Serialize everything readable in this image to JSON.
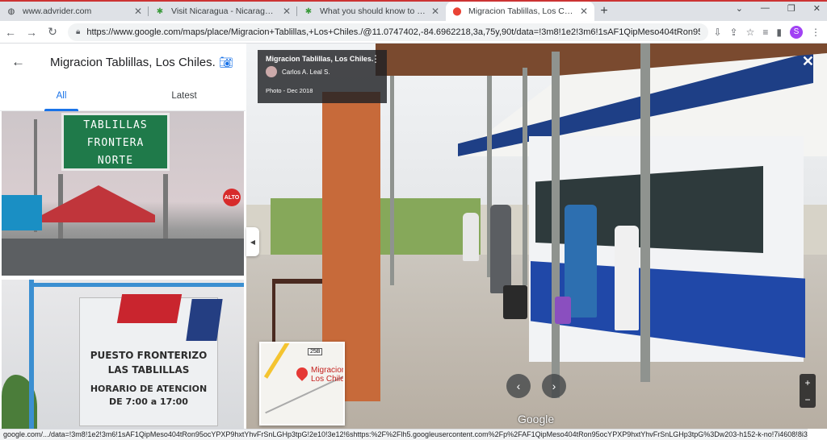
{
  "browser": {
    "tabs": [
      {
        "title": "www.advrider.com",
        "active": false
      },
      {
        "title": "Visit Nicaragua - Nicaragua Touri",
        "active": false
      },
      {
        "title": "What you should know to travel f",
        "active": false
      },
      {
        "title": "Migracion Tablillas, Los Chiles. -",
        "active": true
      }
    ],
    "new_tab": "+",
    "url": "https://www.google.com/maps/place/Migracion+Tablillas,+Los+Chiles./@11.0747402,-84.6962218,3a,75y,90t/data=!3m8!1e2!3m6!1sAF1QipMeso404tRon95..."
  },
  "panel": {
    "title": "Migracion Tablillas, Los Chiles.",
    "tabs": [
      "All",
      "Latest"
    ],
    "photo1_sign": [
      "TABLILLAS",
      "FRONTERA",
      "NORTE"
    ],
    "photo1_stop": "ALTO",
    "photo2_sign": [
      "PUESTO FRONTERIZO",
      "LAS TABLILLAS",
      "HORARIO DE ATENCION",
      "DE 7:00 a 17:00"
    ]
  },
  "viewer": {
    "place_title": "Migracion Tablillas, Los Chiles.",
    "author": "Carlos A. Leal S.",
    "date": "Photo - Dec 2018",
    "watermark": "Google",
    "mini_map": {
      "route": "25B",
      "label": "Migracion Los Chile"
    }
  },
  "status": {
    "text": "google.com/.../data=!3m8!1e2!3m6!1sAF1QipMeso404tRon95ocYPXP9hxtYhvFrSnLGHp3tpG!2e10!3e12!6shttps:%2F%2Flh5.googleusercontent.com%2Fp%2FAF1QipMeso404tRon95ocYPXP9hxtYhvFrSnLGHp3tpG%3Dw203-h152-k-no!7i4608!8i3456!..."
  }
}
